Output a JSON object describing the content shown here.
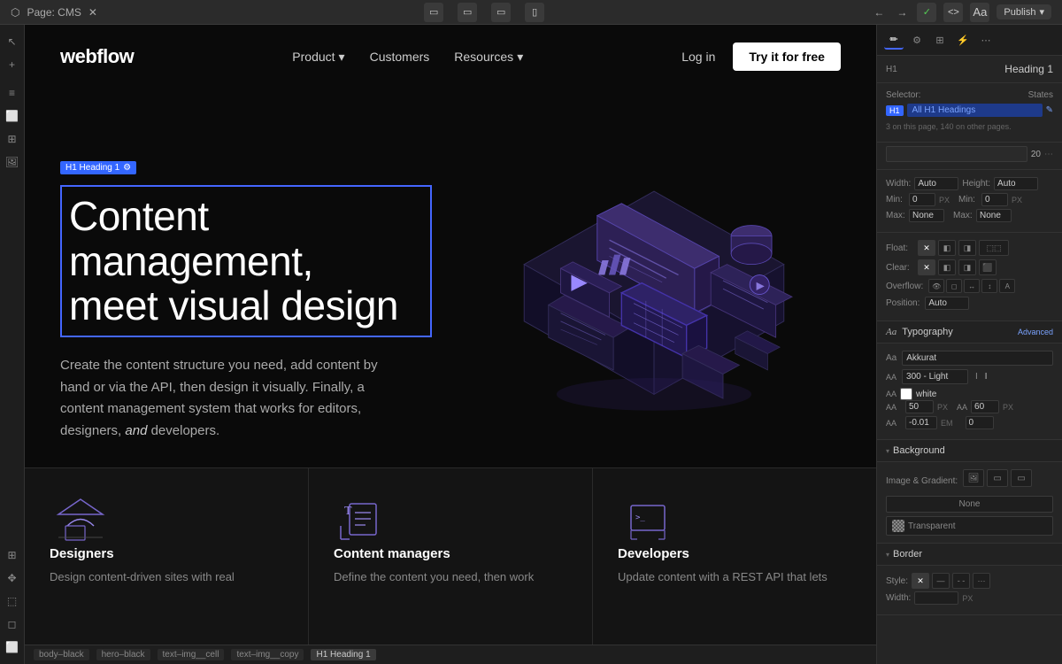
{
  "browser": {
    "tab_label": "Page: CMS",
    "tab_icon": "●",
    "nav_back": "←",
    "nav_forward": "→",
    "publish_label": "Publish",
    "publish_arrow": "▾"
  },
  "navbar": {
    "logo": "webflow",
    "links": [
      {
        "label": "Product",
        "has_arrow": true
      },
      {
        "label": "Customers",
        "has_arrow": false
      },
      {
        "label": "Resources",
        "has_arrow": true
      }
    ],
    "login_label": "Log in",
    "cta_label": "Try it for free"
  },
  "hero": {
    "badge_label": "H1 Heading 1",
    "heading_line1": "Content management,",
    "heading_line2": "meet visual design",
    "subtext": "Create the content structure you need, add content by hand or via the API, then design it visually. Finally, a content management system that works for editors, designers,",
    "subtext_italic": "and",
    "subtext_end": "developers."
  },
  "features": [
    {
      "title": "Designers",
      "desc": "Design content-driven sites with real"
    },
    {
      "title": "Content managers",
      "desc": "Define the content you need, then work"
    },
    {
      "title": "Developers",
      "desc": "Update content with a REST API that lets"
    }
  ],
  "right_panel": {
    "heading_label": "Heading 1",
    "selector_label": "Selector:",
    "states_label": "States",
    "selector_h1": "H1",
    "selector_value": "All H1 Headings",
    "info_text": "3 on this page, 140 on other pages.",
    "width_label": "Width:",
    "width_value": "Auto",
    "height_label": "Height:",
    "height_value": "Auto",
    "min_w_label": "Min:",
    "min_w_value": "0",
    "min_w_unit": "PX",
    "min_h_label": "Min:",
    "min_h_value": "0",
    "min_h_unit": "PX",
    "max_w_label": "Max:",
    "max_w_value": "None",
    "max_h_label": "Max:",
    "max_h_value": "None",
    "float_label": "Float:",
    "clear_label": "Clear:",
    "overflow_label": "Overflow:",
    "position_label": "Position:",
    "position_value": "Auto",
    "typography_title": "Typography",
    "advanced_label": "Advanced",
    "font_label": "Aa",
    "font_value": "Akkurat",
    "weight_value": "300 - Light",
    "size_label": "AA",
    "size_value": "50",
    "size_unit": "PX",
    "lh_value": "60",
    "lh_unit": "PX",
    "ls_value": "-0.01",
    "ls_unit": "EM",
    "ls2_value": "0",
    "color_label": "white",
    "line_height_label": "AA",
    "spacing_num": "20",
    "background_title": "Background",
    "image_gradient_label": "Image & Gradient:",
    "bg_none_label": "None",
    "bg_transparent_label": "Transparent",
    "border_title": "Border",
    "border_style_label": "Style:",
    "border_width_label": "Width:",
    "border_width_unit": "PX"
  },
  "status_bar": {
    "items": [
      "body–black",
      "hero–black",
      "text–img__cell",
      "text–img__copy",
      "H1 Heading 1"
    ]
  }
}
